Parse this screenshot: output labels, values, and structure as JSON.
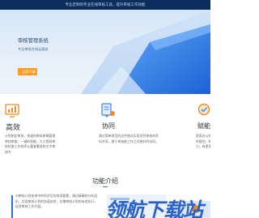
{
  "topbar": {
    "text": "专业定制的专业在线审核工具，提升审核工作效能"
  },
  "hero": {
    "title": "审核管理系统",
    "subtitle": "专业审批在线云服务",
    "button_label": "立即下载"
  },
  "features": [
    {
      "title": "高效",
      "icon": "monitor-chart-icon",
      "desc": "计划制定审核，快速的审核审稿管理审核审查，一键的智能，大大提高审核检查工作效率从重复繁琐的文字审核中"
    },
    {
      "title": "协同",
      "icon": "document-network-icon",
      "desc": "通过简单规范的文件格式实现项目审核的资料共享，便于审核能工作之间更好的协同。"
    },
    {
      "title": "赋能",
      "icon": "magnifier-icon",
      "desc": "提高办公效率，赋能审核中对质量的管控，帮忙提升整体审核管理能力，有更多时间做质量的增能。"
    }
  ],
  "intro": {
    "title": "功能介绍",
    "text": "对审核计划安排中的所涉及的各项要素，通过精确的分析组织，实现审核计划的快速安排，支撑审核计划的有效执行，促进审核工作开展。"
  },
  "watermark": {
    "text": "领航下载站",
    "brand_color": "#2a62c9"
  },
  "colors": {
    "accent": "#ff9a1e",
    "topbar": "#0a2d5c",
    "link": "#2a6fdb"
  }
}
